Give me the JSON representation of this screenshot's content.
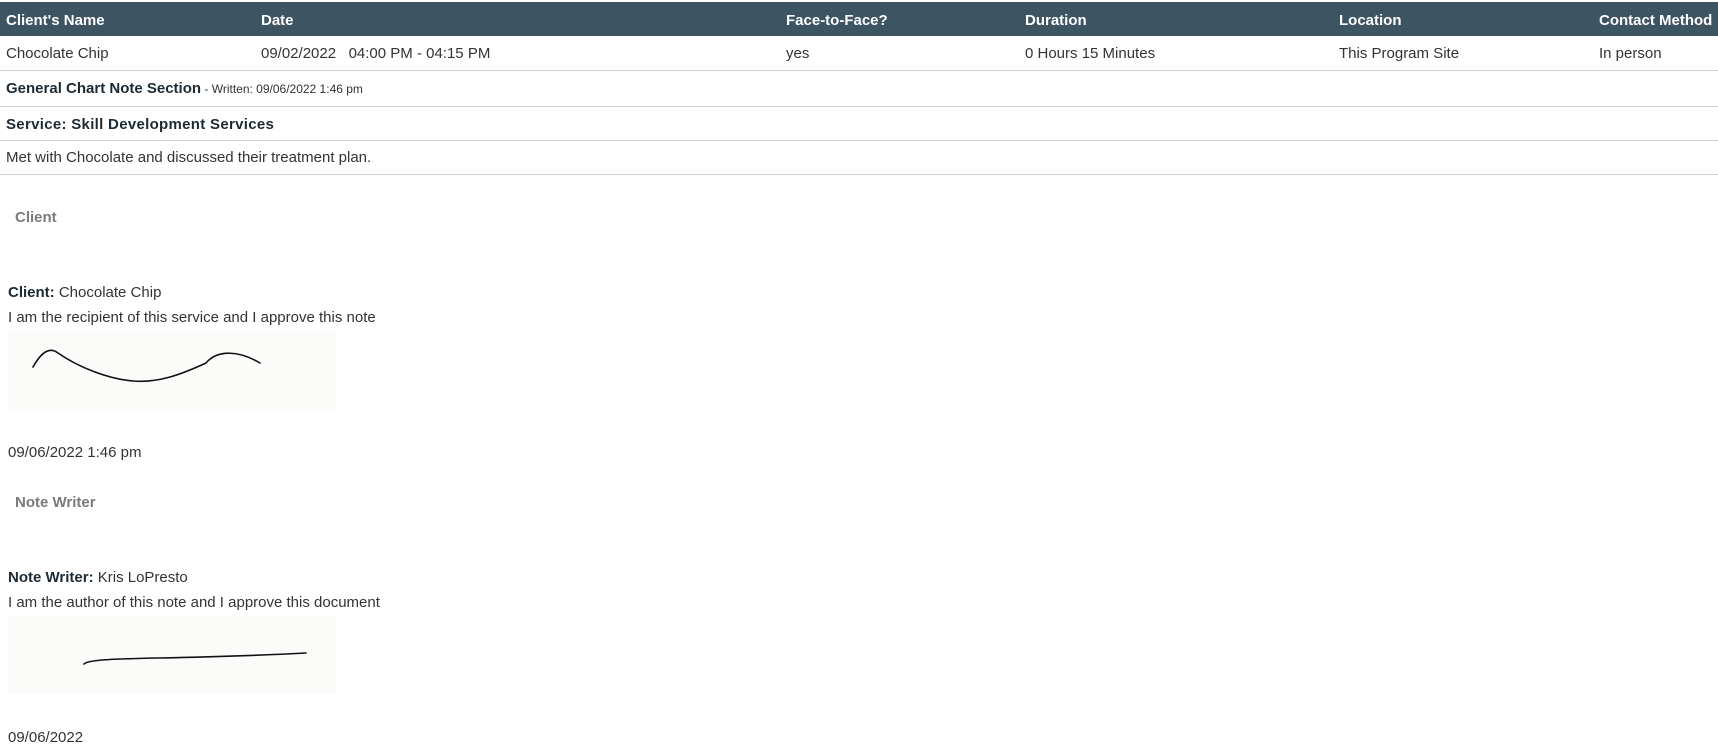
{
  "table": {
    "headers": [
      "Client's Name",
      "Date",
      "Face-to-Face?",
      "Duration",
      "Location",
      "Contact Method"
    ],
    "row": [
      "Chocolate Chip",
      "09/02/2022   04:00 PM - 04:15 PM",
      "yes",
      "0 Hours 15 Minutes",
      "This Program Site",
      "In person"
    ]
  },
  "note": {
    "section_title": "General Chart Note Section",
    "written_label": " - Written: 09/06/2022 1:46 pm",
    "service": "Service: Skill Development Services",
    "body": "Met with Chocolate and discussed their treatment plan."
  },
  "client_sig": {
    "section_label": "Client",
    "name_label": "Client:",
    "name": "Chocolate Chip",
    "statement": "I am the recipient of this service and I approve this note",
    "date": "09/06/2022 1:46 pm"
  },
  "writer_sig": {
    "section_label": "Note Writer",
    "name_label": "Note Writer:",
    "name": "Kris LoPresto",
    "statement": "I am the author of this note and I approve this document",
    "date": "09/06/2022"
  },
  "colors": {
    "header_bg": "#3d5463",
    "header_text": "#ffffff",
    "divider": "#cfcfcf",
    "signature_bg": "#fbfcfa"
  }
}
